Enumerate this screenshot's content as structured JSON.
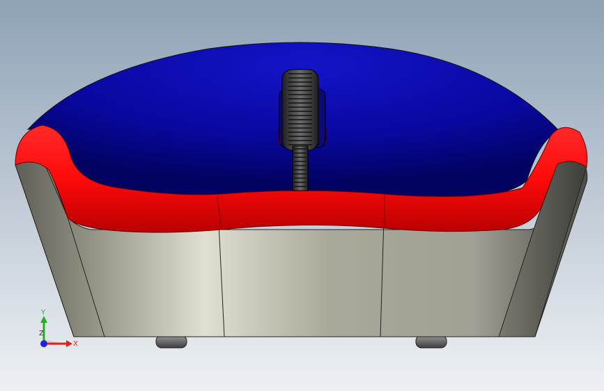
{
  "viewport": {
    "background_top": "#8fa2b6",
    "background_bottom": "#eef1f4"
  },
  "model": {
    "shell_color": "#0a0a9a",
    "trim_color": "#ff0c0c",
    "base_color": "#b9b9a8",
    "wheel_color": "#3a3a3a",
    "feet_color": "#6a6a6a"
  },
  "triad": {
    "x_label": "X",
    "y_label": "Y",
    "z_label": "Z",
    "x_color": "#e02020",
    "y_color": "#20b020",
    "z_color": "#2020e0"
  }
}
